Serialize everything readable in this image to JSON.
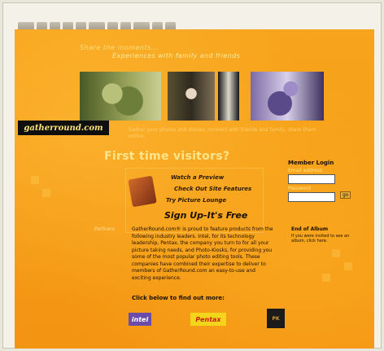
{
  "header": {
    "tagline": "Share the moments...",
    "tagline_sub": "Experiences with family and friends"
  },
  "logo": {
    "text": "gatherround.com"
  },
  "banner": {
    "caption": "Gather your photos and stories, connect with friends and family, share them online."
  },
  "intro": {
    "first_time_label": "First time visitors?"
  },
  "features": [
    {
      "label": "Watch a Preview"
    },
    {
      "label": "Check Out Site Features"
    },
    {
      "label": "Try Picture Lounge"
    }
  ],
  "signup": {
    "label": "Sign Up-It's Free"
  },
  "login": {
    "title": "Member Login",
    "email_label": "Email address",
    "password_label": "Password",
    "go_label": "go"
  },
  "album_note": {
    "title": "End of Album",
    "body": "If you were invited to see an album, click here."
  },
  "body": {
    "side_label": "Partners",
    "paragraph": "GatherRound.com® is proud to feature products from the following industry leaders. Intel, for its technology leadership, Pentax, the company you turn to for all your picture taking needs, and Photo-Kiosks, for providing you some of the most popular photo editing tools. These companies have combined their expertise to deliver to members of GatherRound.com an easy-to-use and exciting experience.",
    "click_below": "Click below to find out more:"
  },
  "partners": [
    {
      "name": "intel"
    },
    {
      "name": "Pentax"
    },
    {
      "name": "PK"
    }
  ]
}
